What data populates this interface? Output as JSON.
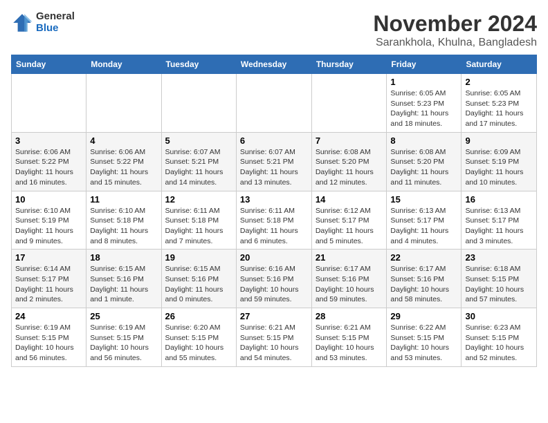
{
  "logo": {
    "general": "General",
    "blue": "Blue"
  },
  "title": "November 2024",
  "location": "Sarankhola, Khulna, Bangladesh",
  "days_of_week": [
    "Sunday",
    "Monday",
    "Tuesday",
    "Wednesday",
    "Thursday",
    "Friday",
    "Saturday"
  ],
  "weeks": [
    [
      {
        "day": "",
        "info": ""
      },
      {
        "day": "",
        "info": ""
      },
      {
        "day": "",
        "info": ""
      },
      {
        "day": "",
        "info": ""
      },
      {
        "day": "",
        "info": ""
      },
      {
        "day": "1",
        "info": "Sunrise: 6:05 AM\nSunset: 5:23 PM\nDaylight: 11 hours and 18 minutes."
      },
      {
        "day": "2",
        "info": "Sunrise: 6:05 AM\nSunset: 5:23 PM\nDaylight: 11 hours and 17 minutes."
      }
    ],
    [
      {
        "day": "3",
        "info": "Sunrise: 6:06 AM\nSunset: 5:22 PM\nDaylight: 11 hours and 16 minutes."
      },
      {
        "day": "4",
        "info": "Sunrise: 6:06 AM\nSunset: 5:22 PM\nDaylight: 11 hours and 15 minutes."
      },
      {
        "day": "5",
        "info": "Sunrise: 6:07 AM\nSunset: 5:21 PM\nDaylight: 11 hours and 14 minutes."
      },
      {
        "day": "6",
        "info": "Sunrise: 6:07 AM\nSunset: 5:21 PM\nDaylight: 11 hours and 13 minutes."
      },
      {
        "day": "7",
        "info": "Sunrise: 6:08 AM\nSunset: 5:20 PM\nDaylight: 11 hours and 12 minutes."
      },
      {
        "day": "8",
        "info": "Sunrise: 6:08 AM\nSunset: 5:20 PM\nDaylight: 11 hours and 11 minutes."
      },
      {
        "day": "9",
        "info": "Sunrise: 6:09 AM\nSunset: 5:19 PM\nDaylight: 11 hours and 10 minutes."
      }
    ],
    [
      {
        "day": "10",
        "info": "Sunrise: 6:10 AM\nSunset: 5:19 PM\nDaylight: 11 hours and 9 minutes."
      },
      {
        "day": "11",
        "info": "Sunrise: 6:10 AM\nSunset: 5:18 PM\nDaylight: 11 hours and 8 minutes."
      },
      {
        "day": "12",
        "info": "Sunrise: 6:11 AM\nSunset: 5:18 PM\nDaylight: 11 hours and 7 minutes."
      },
      {
        "day": "13",
        "info": "Sunrise: 6:11 AM\nSunset: 5:18 PM\nDaylight: 11 hours and 6 minutes."
      },
      {
        "day": "14",
        "info": "Sunrise: 6:12 AM\nSunset: 5:17 PM\nDaylight: 11 hours and 5 minutes."
      },
      {
        "day": "15",
        "info": "Sunrise: 6:13 AM\nSunset: 5:17 PM\nDaylight: 11 hours and 4 minutes."
      },
      {
        "day": "16",
        "info": "Sunrise: 6:13 AM\nSunset: 5:17 PM\nDaylight: 11 hours and 3 minutes."
      }
    ],
    [
      {
        "day": "17",
        "info": "Sunrise: 6:14 AM\nSunset: 5:17 PM\nDaylight: 11 hours and 2 minutes."
      },
      {
        "day": "18",
        "info": "Sunrise: 6:15 AM\nSunset: 5:16 PM\nDaylight: 11 hours and 1 minute."
      },
      {
        "day": "19",
        "info": "Sunrise: 6:15 AM\nSunset: 5:16 PM\nDaylight: 11 hours and 0 minutes."
      },
      {
        "day": "20",
        "info": "Sunrise: 6:16 AM\nSunset: 5:16 PM\nDaylight: 10 hours and 59 minutes."
      },
      {
        "day": "21",
        "info": "Sunrise: 6:17 AM\nSunset: 5:16 PM\nDaylight: 10 hours and 59 minutes."
      },
      {
        "day": "22",
        "info": "Sunrise: 6:17 AM\nSunset: 5:16 PM\nDaylight: 10 hours and 58 minutes."
      },
      {
        "day": "23",
        "info": "Sunrise: 6:18 AM\nSunset: 5:15 PM\nDaylight: 10 hours and 57 minutes."
      }
    ],
    [
      {
        "day": "24",
        "info": "Sunrise: 6:19 AM\nSunset: 5:15 PM\nDaylight: 10 hours and 56 minutes."
      },
      {
        "day": "25",
        "info": "Sunrise: 6:19 AM\nSunset: 5:15 PM\nDaylight: 10 hours and 56 minutes."
      },
      {
        "day": "26",
        "info": "Sunrise: 6:20 AM\nSunset: 5:15 PM\nDaylight: 10 hours and 55 minutes."
      },
      {
        "day": "27",
        "info": "Sunrise: 6:21 AM\nSunset: 5:15 PM\nDaylight: 10 hours and 54 minutes."
      },
      {
        "day": "28",
        "info": "Sunrise: 6:21 AM\nSunset: 5:15 PM\nDaylight: 10 hours and 53 minutes."
      },
      {
        "day": "29",
        "info": "Sunrise: 6:22 AM\nSunset: 5:15 PM\nDaylight: 10 hours and 53 minutes."
      },
      {
        "day": "30",
        "info": "Sunrise: 6:23 AM\nSunset: 5:15 PM\nDaylight: 10 hours and 52 minutes."
      }
    ]
  ]
}
